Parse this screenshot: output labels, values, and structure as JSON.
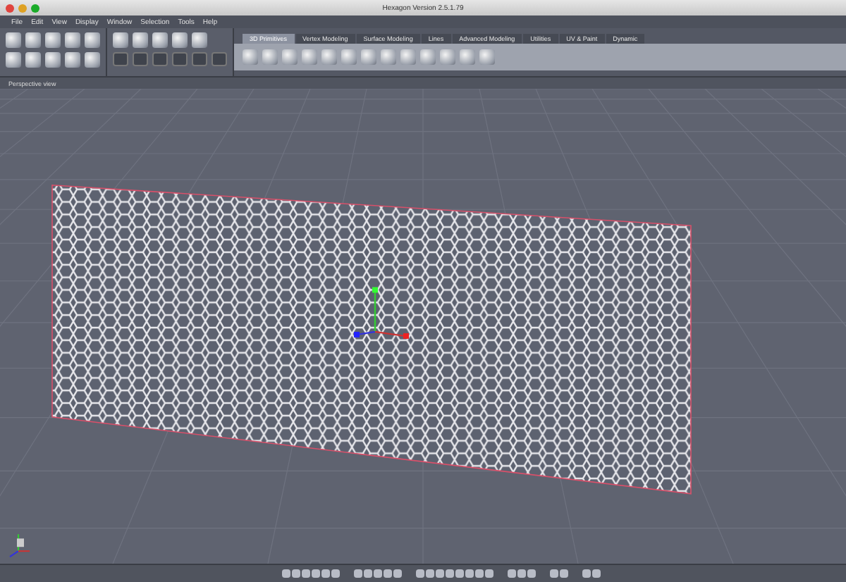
{
  "window": {
    "title": "Hexagon Version 2.5.1.79"
  },
  "menu": [
    "File",
    "Edit",
    "View",
    "Display",
    "Window",
    "Selection",
    "Tools",
    "Help"
  ],
  "tabs": [
    {
      "label": "3D Primitives",
      "selected": true
    },
    {
      "label": "Vertex Modeling",
      "selected": false
    },
    {
      "label": "Surface Modeling",
      "selected": false
    },
    {
      "label": "Lines",
      "selected": false
    },
    {
      "label": "Advanced Modeling",
      "selected": false
    },
    {
      "label": "Utilities",
      "selected": false
    },
    {
      "label": "UV & Paint",
      "selected": false
    },
    {
      "label": "Dynamic",
      "selected": false
    }
  ],
  "viewport": {
    "label": "Perspective view"
  }
}
